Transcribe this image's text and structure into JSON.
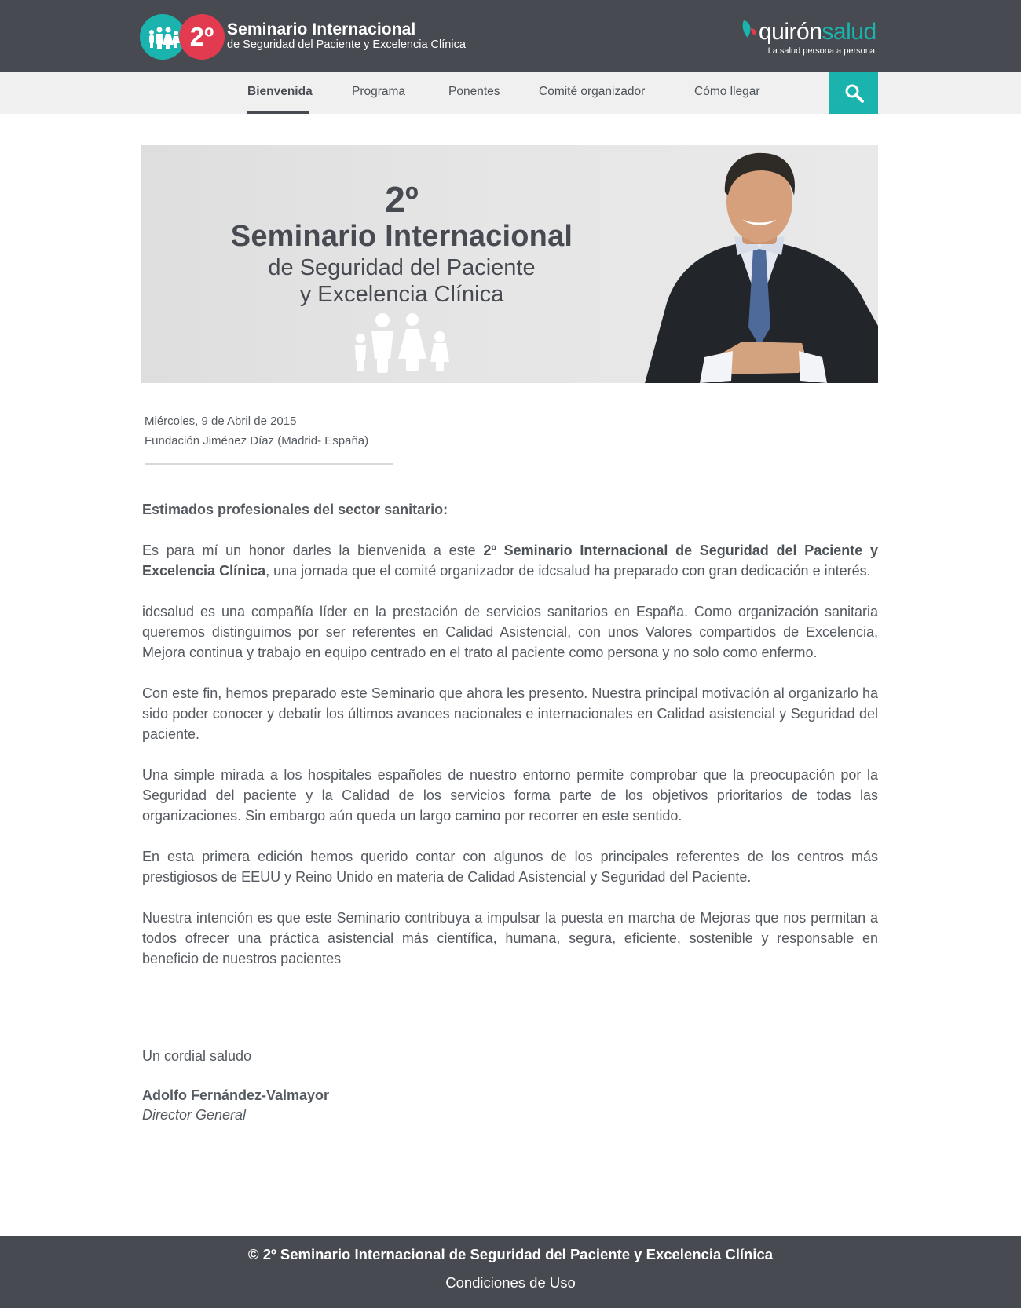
{
  "colors": {
    "header_bg": "#474b51",
    "accent_teal": "#1ab3ad",
    "accent_red": "#e23a4e",
    "nav_bg": "#f0f0f0",
    "text": "#555a60"
  },
  "header": {
    "logo_number": "2º",
    "title": "Seminario Internacional",
    "subtitle": "de Seguridad del Paciente y Excelencia Clínica",
    "partner": {
      "name_part1": "quirón",
      "name_part2": "salud",
      "tagline": "La salud persona a persona"
    }
  },
  "nav": {
    "items": [
      {
        "label": "Bienvenida",
        "active": true
      },
      {
        "label": "Programa"
      },
      {
        "label": "Ponentes"
      },
      {
        "label": "Comité organizador"
      },
      {
        "label": "Cómo llegar"
      }
    ],
    "search_icon": "search-icon"
  },
  "banner": {
    "number": "2º",
    "title": "Seminario Internacional",
    "line1": "de Seguridad del Paciente",
    "line2": "y Excelencia Clínica"
  },
  "event": {
    "date": "Miércoles, 9 de Abril de 2015",
    "place": "Fundación Jiménez Díaz (Madrid- España)"
  },
  "letter": {
    "greeting": "Estimados profesionales del sector sanitario:",
    "p1_a": "Es para mí un honor darles la bienvenida a este ",
    "p1_bold": "2º Seminario Internacional de Seguridad del Paciente y Excelencia Clínica",
    "p1_b": ",  una  jornada que el comité organizador de idcsalud ha preparado con gran dedicación e interés.",
    "p2": "idcsalud es  una compañía líder en  la prestación de servicios sanitarios en España. Como organización sanitaria  queremos distinguirnos por ser referentes en Calidad Asistencial, con unos Valores compartidos de Excelencia, Mejora continua y trabajo en equipo centrado en el trato al paciente como persona y no solo como enfermo.",
    "p3": "Con este fin, hemos preparado este Seminario que ahora les presento. Nuestra principal motivación al organizarlo ha sido  poder conocer y debatir los últimos avances nacionales e internacionales en Calidad asistencial y Seguridad del paciente.",
    "p4": "Una simple mirada a los hospitales españoles de nuestro entorno permite comprobar que la preocupación por la Seguridad del paciente y la Calidad de los servicios forma parte de los objetivos prioritarios de todas las  organizaciones. Sin embargo aún queda un largo camino por recorrer en este sentido.",
    "p5": "En esta primera edición hemos querido contar con algunos de los principales referentes de los centros más prestigiosos de EEUU y Reino Unido en materia de Calidad Asistencial y Seguridad del Paciente.",
    "p6": "Nuestra intención es que este Seminario contribuya a impulsar la puesta en marcha de Mejoras que nos permitan a todos ofrecer una práctica asistencial más científica, humana, segura, eficiente, sostenible y responsable en beneficio de nuestros pacientes",
    "closing": "Un cordial saludo",
    "signer": "Adolfo Fernández-Valmayor",
    "signer_role": "Director General"
  },
  "footer": {
    "copyright": "© 2º Seminario Internacional de Seguridad del Paciente y Excelencia Clínica",
    "terms_link": "Condiciones de Uso"
  }
}
